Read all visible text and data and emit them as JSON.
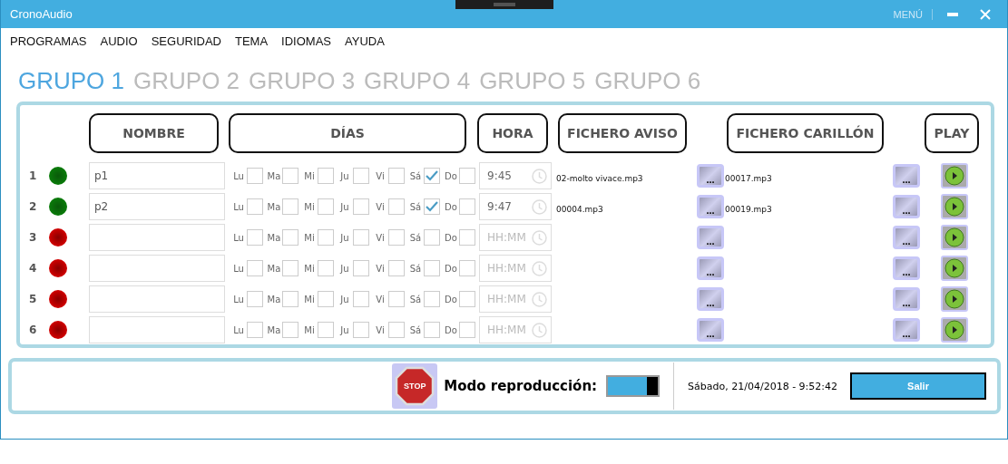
{
  "window": {
    "title": "CronoAudio",
    "menu_label": "MENÚ"
  },
  "menu": [
    "PROGRAMAS",
    "AUDIO",
    "SEGURIDAD",
    "TEMA",
    "IDIOMAS",
    "AYUDA"
  ],
  "tabs": [
    {
      "label": "GRUPO 1",
      "selected": true
    },
    {
      "label": "GRUPO 2",
      "selected": false
    },
    {
      "label": "GRUPO 3",
      "selected": false
    },
    {
      "label": "GRUPO 4",
      "selected": false
    },
    {
      "label": "GRUPO 5",
      "selected": false
    },
    {
      "label": "GRUPO 6",
      "selected": false
    }
  ],
  "columns": [
    "NOMBRE",
    "DÍAS",
    "HORA",
    "FICHERO AVISO",
    "FICHERO CARILLÓN",
    "PLAY"
  ],
  "rows": [
    {
      "number": "1",
      "active": true,
      "name": "p1",
      "days": [
        {
          "label": "Lu",
          "checked": false
        },
        {
          "label": "Ma",
          "checked": false
        },
        {
          "label": "Mi",
          "checked": false
        },
        {
          "label": "Ju",
          "checked": false
        },
        {
          "label": "Vi",
          "checked": false
        },
        {
          "label": "Sá",
          "checked": true
        },
        {
          "label": "Do",
          "checked": false
        }
      ],
      "time": {
        "value": "9:45"
      },
      "aviso": "02-molto vivace.mp3",
      "aviso_button": "...",
      "carillon": "00017.mp3",
      "carillon_button": "..."
    },
    {
      "number": "2",
      "active": true,
      "name": "p2",
      "days": [
        {
          "label": "Lu",
          "checked": false
        },
        {
          "label": "Ma",
          "checked": false
        },
        {
          "label": "Mi",
          "checked": false
        },
        {
          "label": "Ju",
          "checked": false
        },
        {
          "label": "Vi",
          "checked": false
        },
        {
          "label": "Sá",
          "checked": true
        },
        {
          "label": "Do",
          "checked": false
        }
      ],
      "time": {
        "value": "9:47"
      },
      "aviso": "00004.mp3",
      "aviso_button": "...",
      "carillon": "00019.mp3",
      "carillon_button": "..."
    },
    {
      "number": "3",
      "active": false,
      "days": [
        {
          "label": "Lu",
          "checked": false
        },
        {
          "label": "Ma",
          "checked": false
        },
        {
          "label": "Mi",
          "checked": false
        },
        {
          "label": "Ju",
          "checked": false
        },
        {
          "label": "Vi",
          "checked": false
        },
        {
          "label": "Sá",
          "checked": false
        },
        {
          "label": "Do",
          "checked": false
        }
      ],
      "time": {
        "placeholder": "HH:MM"
      },
      "aviso_button": "...",
      "carillon_button": "..."
    },
    {
      "number": "4",
      "active": false,
      "days": [
        {
          "label": "Lu",
          "checked": false
        },
        {
          "label": "Ma",
          "checked": false
        },
        {
          "label": "Mi",
          "checked": false
        },
        {
          "label": "Ju",
          "checked": false
        },
        {
          "label": "Vi",
          "checked": false
        },
        {
          "label": "Sá",
          "checked": false
        },
        {
          "label": "Do",
          "checked": false
        }
      ],
      "time": {
        "placeholder": "HH:MM"
      },
      "aviso_button": "...",
      "carillon_button": "..."
    },
    {
      "number": "5",
      "active": false,
      "days": [
        {
          "label": "Lu",
          "checked": false
        },
        {
          "label": "Ma",
          "checked": false
        },
        {
          "label": "Mi",
          "checked": false
        },
        {
          "label": "Ju",
          "checked": false
        },
        {
          "label": "Vi",
          "checked": false
        },
        {
          "label": "Sá",
          "checked": false
        },
        {
          "label": "Do",
          "checked": false
        }
      ],
      "time": {
        "placeholder": "HH:MM"
      },
      "aviso_button": "...",
      "carillon_button": "..."
    },
    {
      "number": "6",
      "active": false,
      "days": [
        {
          "label": "Lu",
          "checked": false
        },
        {
          "label": "Ma",
          "checked": false
        },
        {
          "label": "Mi",
          "checked": false
        },
        {
          "label": "Ju",
          "checked": false
        },
        {
          "label": "Vi",
          "checked": false
        },
        {
          "label": "Sá",
          "checked": false
        },
        {
          "label": "Do",
          "checked": false
        }
      ],
      "time": {
        "placeholder": "HH:MM"
      },
      "aviso_button": "...",
      "carillon_button": "..."
    }
  ],
  "footer": {
    "stop_label": "STOP",
    "mode_label": "Modo reproducción:",
    "mode_on": true,
    "datetime": "Sábado, 21/04/2018 - 9:52:42",
    "exit_button": "Salir"
  }
}
